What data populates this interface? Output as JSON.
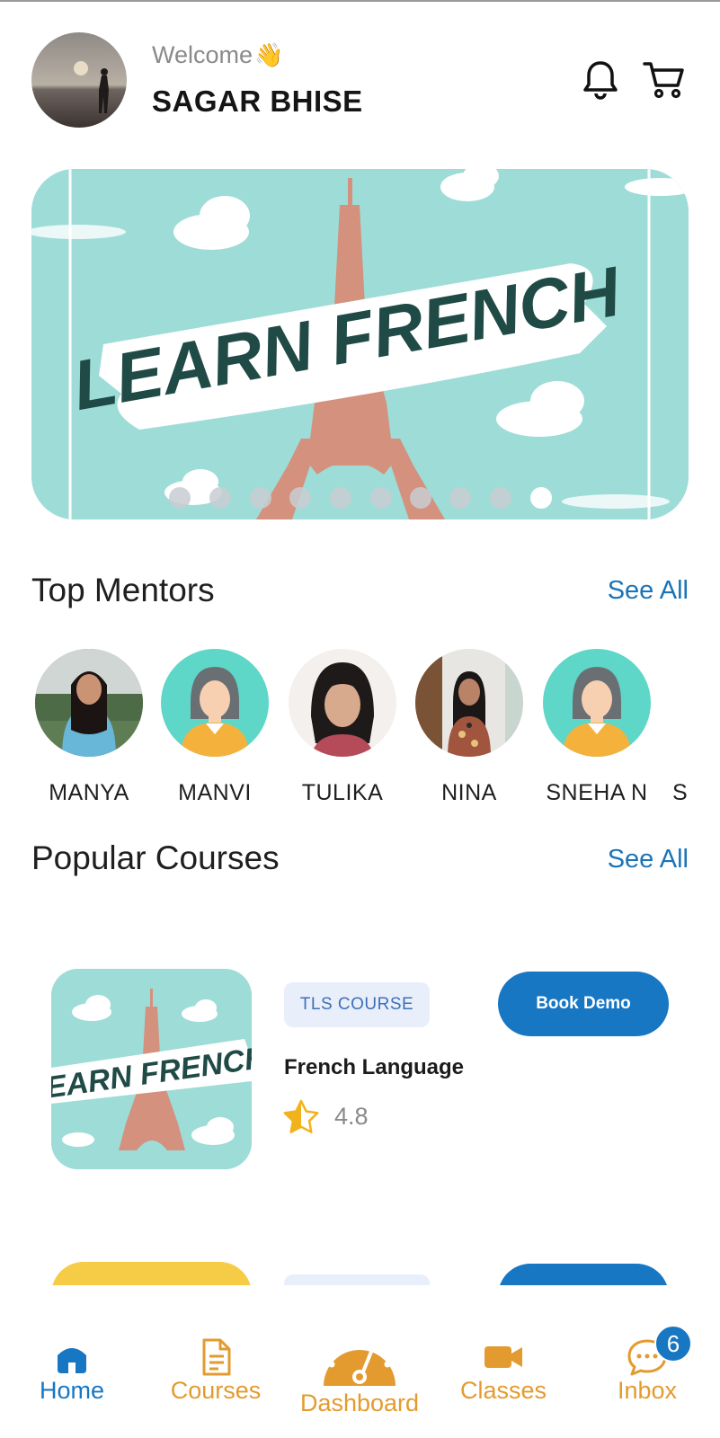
{
  "header": {
    "welcome": "Welcome",
    "wave_emoji": "👋",
    "user_name": "SAGAR BHISE"
  },
  "banner": {
    "title": "LEARN FRENCH",
    "slide_count": 10,
    "active_slide": 10
  },
  "mentors": {
    "title": "Top Mentors",
    "see_all": "See All",
    "items": [
      {
        "name": "MANYA"
      },
      {
        "name": "MANVI"
      },
      {
        "name": "TULIKA"
      },
      {
        "name": "NINA"
      },
      {
        "name": "SNEHA N"
      },
      {
        "name": "SI"
      }
    ]
  },
  "courses": {
    "title": "Popular Courses",
    "see_all": "See All",
    "items": [
      {
        "tag": "TLS COURSE",
        "title": "French Language",
        "rating": "4.8",
        "action": "Book Demo",
        "thumb_text": "LEARN FRENCH"
      }
    ]
  },
  "nav": {
    "items": [
      {
        "label": "Home",
        "icon": "home-icon"
      },
      {
        "label": "Courses",
        "icon": "document-icon"
      },
      {
        "label": "Dashboard",
        "icon": "speedometer-icon"
      },
      {
        "label": "Classes",
        "icon": "video-camera-icon"
      },
      {
        "label": "Inbox",
        "icon": "chat-bubble-icon",
        "badge": "6"
      }
    ]
  },
  "colors": {
    "primary": "#1877c3",
    "accent": "#e39b2f",
    "banner_bg": "#9edcd8"
  }
}
